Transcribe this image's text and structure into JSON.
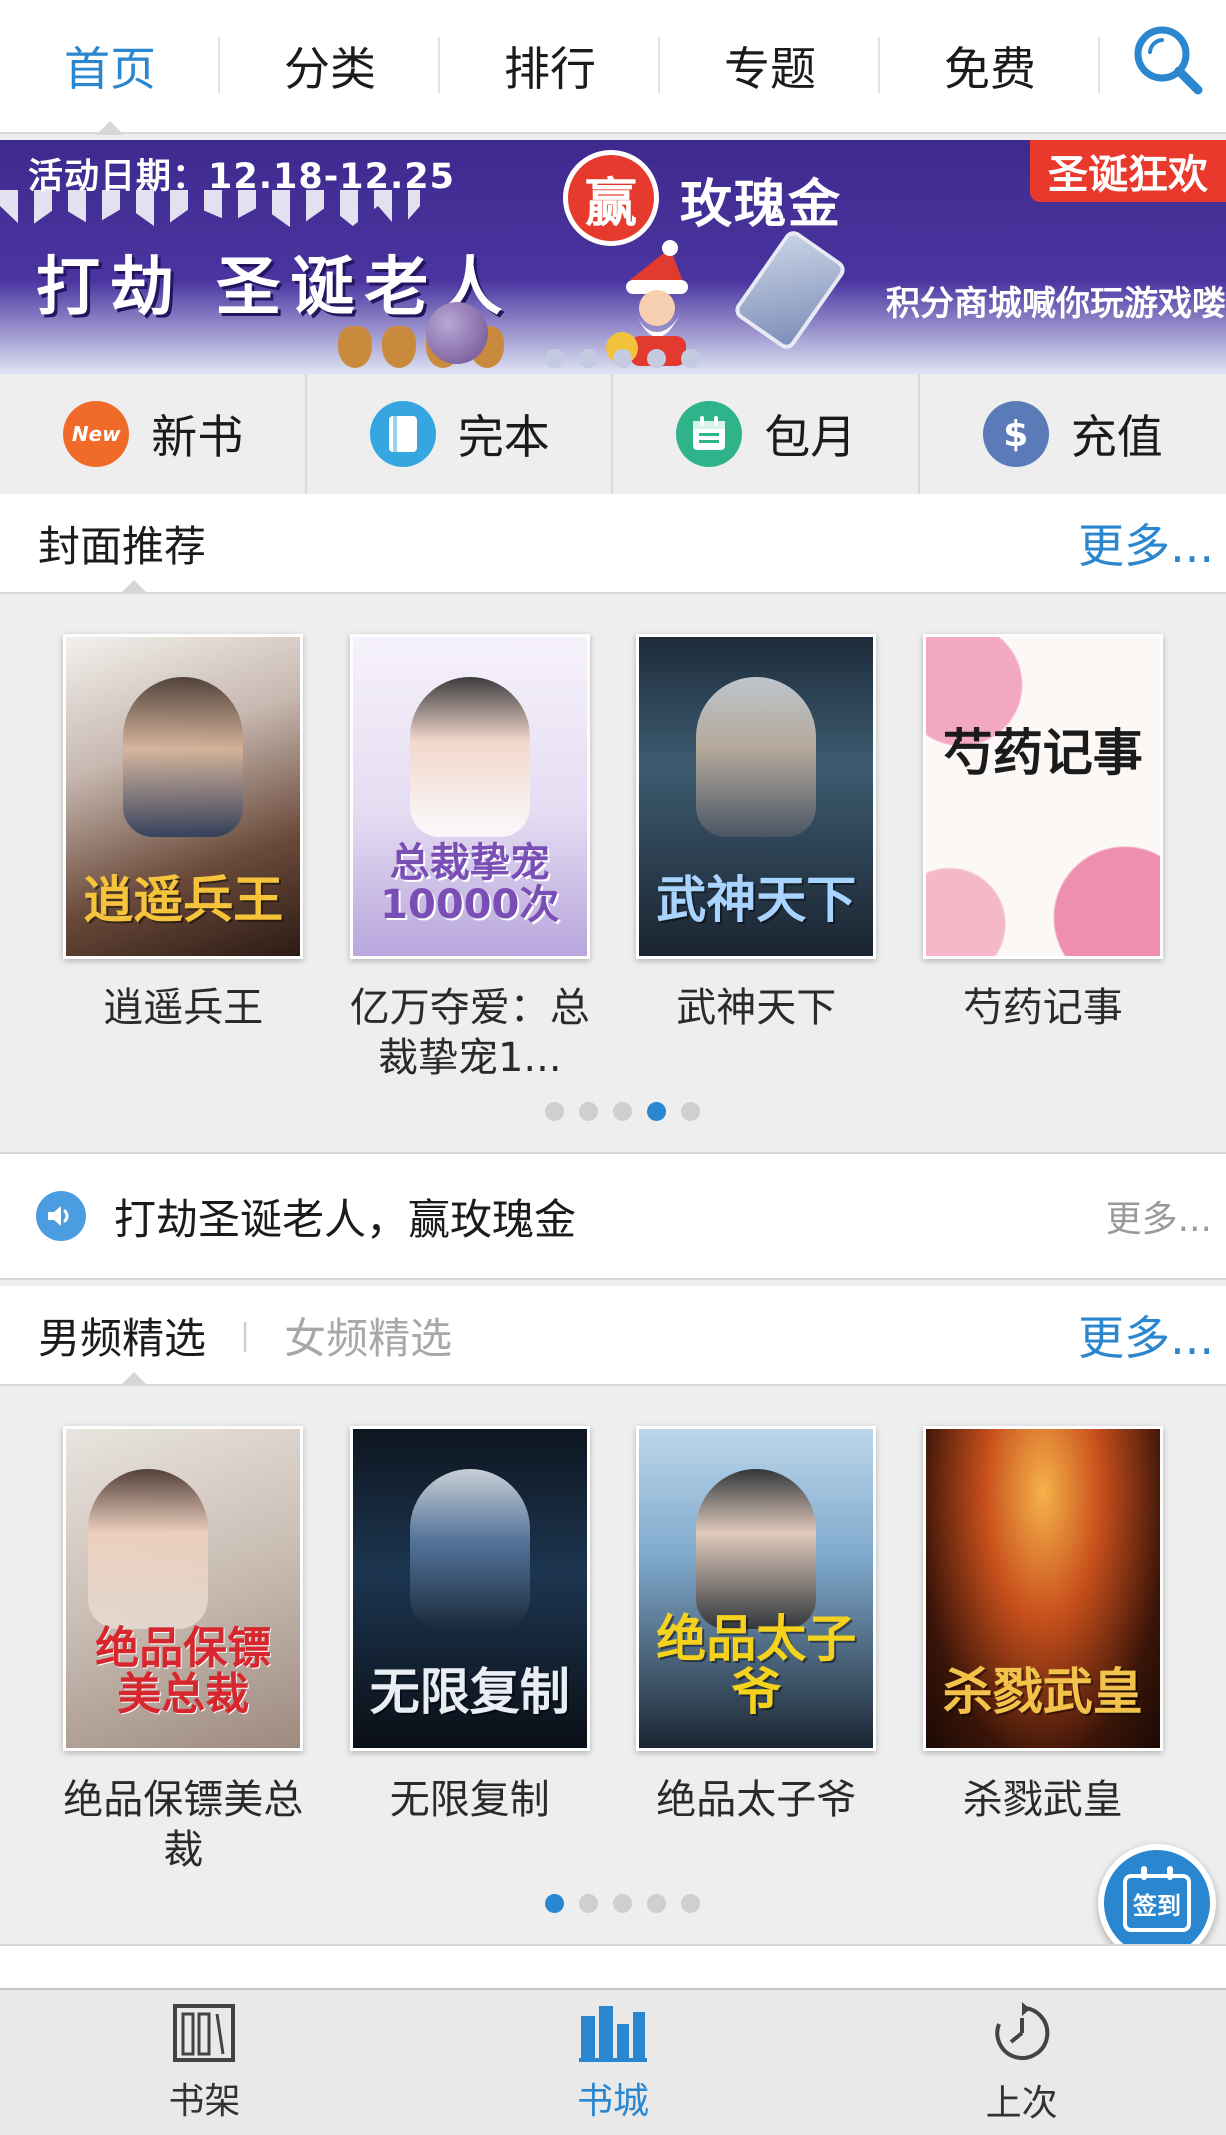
{
  "top_nav": {
    "tabs": [
      {
        "label": "首页",
        "active": true
      },
      {
        "label": "分类",
        "active": false
      },
      {
        "label": "排行",
        "active": false
      },
      {
        "label": "专题",
        "active": false
      },
      {
        "label": "免费",
        "active": false
      }
    ],
    "search_icon": "search-icon"
  },
  "banner": {
    "date": "活动日期：12.18-12.25",
    "headline": "打劫 圣诞老人",
    "win_badge": "赢",
    "prize": "玫瑰金",
    "festival": "圣诞狂欢",
    "slogan": "积分商城喊你玩游戏喽",
    "dots_total": 5,
    "dots_active": 0
  },
  "quick_entries": [
    {
      "label": "新书",
      "icon": "new-badge-icon",
      "icon_text": "New",
      "color": "#f06a2a"
    },
    {
      "label": "完本",
      "icon": "book-icon",
      "color": "#35a6e0"
    },
    {
      "label": "包月",
      "icon": "calendar-icon",
      "color": "#2fb38b"
    },
    {
      "label": "充值",
      "icon": "dollar-icon",
      "icon_text": "$",
      "color": "#5b7bb8"
    }
  ],
  "cover_section": {
    "title": "封面推荐",
    "more": "更多...",
    "books": [
      {
        "name": "逍遥兵王",
        "cover_title": "逍遥兵王"
      },
      {
        "name": "亿万夺爱：总裁挚宠1...",
        "cover_title": "总裁挚宠10000次"
      },
      {
        "name": "武神天下",
        "cover_title": "武神天下"
      },
      {
        "name": "芍药记事",
        "cover_title": "芍药记事"
      }
    ],
    "dots_total": 5,
    "dots_active": 3
  },
  "notice": {
    "text": "打劫圣诞老人，赢玫瑰金",
    "more": "更多..."
  },
  "pick_section": {
    "tab_male": "男频精选",
    "tab_female": "女频精选",
    "more": "更多...",
    "books": [
      {
        "name": "绝品保镖美总裁",
        "cover_title": "绝品保镖美总裁"
      },
      {
        "name": "无限复制",
        "cover_title": "无限复制"
      },
      {
        "name": "绝品太子爷",
        "cover_title": "绝品太子爷"
      },
      {
        "name": "杀戮武皇",
        "cover_title": "杀戮武皇"
      }
    ],
    "dots_total": 5,
    "dots_active": 0
  },
  "signin": {
    "label": "签到"
  },
  "bottom_nav": [
    {
      "label": "书架",
      "icon": "bookshelf-icon",
      "active": false
    },
    {
      "label": "书城",
      "icon": "bookstore-icon",
      "active": true
    },
    {
      "label": "上次",
      "icon": "history-icon",
      "active": false
    }
  ],
  "colors": {
    "accent": "#2a86cf",
    "background": "#eeeeee"
  }
}
